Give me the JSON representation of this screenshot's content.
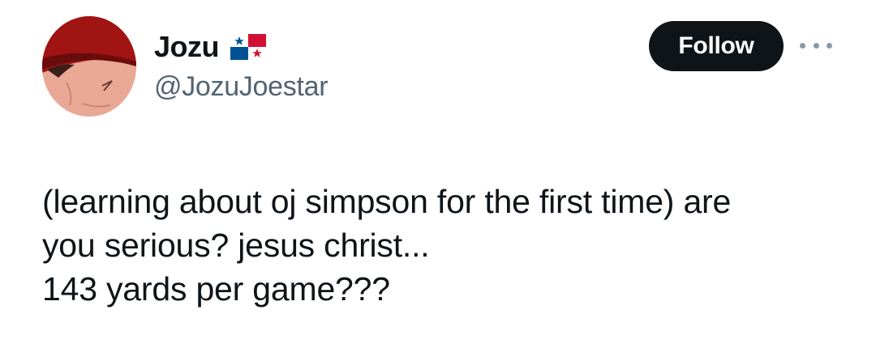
{
  "author": {
    "display_name": "Jozu",
    "handle": "@JozuJoestar",
    "flag_icon": "panama-flag-icon",
    "avatar_icon": "cartoon-profile-avatar"
  },
  "actions": {
    "follow_label": "Follow",
    "more_icon": "more-options-icon"
  },
  "tweet": {
    "lines": [
      "(learning about oj simpson for the first time) are",
      "you serious? jesus christ...",
      "143 yards per game???"
    ]
  },
  "colors": {
    "text_primary": "#0f1419",
    "text_secondary": "#536471",
    "follow_bg": "#0f1419",
    "follow_text": "#ffffff"
  }
}
